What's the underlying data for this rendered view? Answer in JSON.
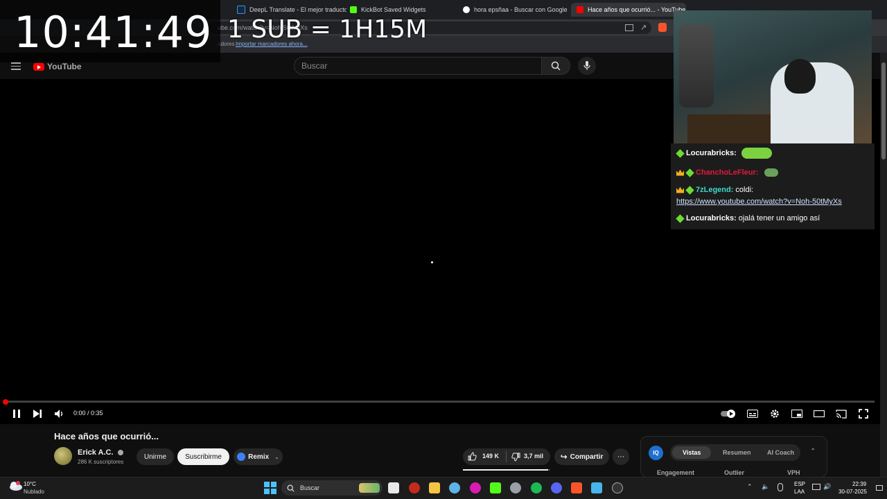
{
  "overlay": {
    "clock": "10:41:49",
    "sub_rate": "1 SUB = 1H15M"
  },
  "browser": {
    "tabs": [
      {
        "label": "DeepL Translate - El mejor traductor",
        "favicon_color": "#0f2b46"
      },
      {
        "label": "KickBot Saved Widgets",
        "favicon_color": "#53fc18"
      },
      {
        "label": "hora epsñaa - Buscar con Google",
        "favicon_color": "#ffffff"
      },
      {
        "label": "Hace años que ocurrió... - YouTube",
        "favicon_color": "#ff0000"
      }
    ],
    "url_partial": "ube.com/watch?v=Noh-50tMyXs",
    "bookmarks": {
      "suffix": "adores",
      "import_link": "Importar marcadores ahora..."
    }
  },
  "youtube": {
    "logo": "YouTube",
    "search_placeholder": "Buscar",
    "player": {
      "time": "0:00 / 0:35",
      "progress": 0.0
    },
    "video_title": "Hace años que ocurrió...",
    "channel": {
      "name": "Erick A.C.",
      "subscribers": "286 K suscriptores"
    },
    "buttons": {
      "join": "Unirme",
      "subscribe": "Suscribirme",
      "remix": "Remix",
      "likes": "149 K",
      "dislikes": "3,7 mil",
      "share": "Compartir"
    },
    "like_ratio": 0.976
  },
  "iq_panel": {
    "badge": "IQ",
    "tabs": [
      "Vistas",
      "Resumen",
      "AI Coach"
    ],
    "active_tab": "Vistas",
    "columns": [
      "Engagement",
      "Outlier",
      "VPH"
    ]
  },
  "chat": {
    "messages": [
      {
        "user": "Locurabricks:",
        "user_color": "#ffffff",
        "text": "",
        "badges": [
          "gem"
        ]
      },
      {
        "user": "ChanchoLeFleur:",
        "user_color": "#e0193b",
        "text": "",
        "badges": [
          "crown",
          "gem"
        ]
      },
      {
        "user": "7zLegend:",
        "user_color": "#3fd9c7",
        "text": "coldi:",
        "badges": [
          "crown",
          "gem"
        ]
      },
      {
        "user": "Locurabricks:",
        "user_color": "#ffffff",
        "text": "ojalá tener un amigo así",
        "badges": [
          "gem"
        ]
      }
    ],
    "link": "https://www.youtube.com/watch?v=Noh-50tMyXs"
  },
  "taskbar": {
    "weather": {
      "temp": "10°C",
      "condition": "Nublado"
    },
    "search_label": "Buscar",
    "lang": {
      "line1": "ESP",
      "line2": "LAA"
    },
    "time": "22:39",
    "date": "30-07-2025"
  }
}
